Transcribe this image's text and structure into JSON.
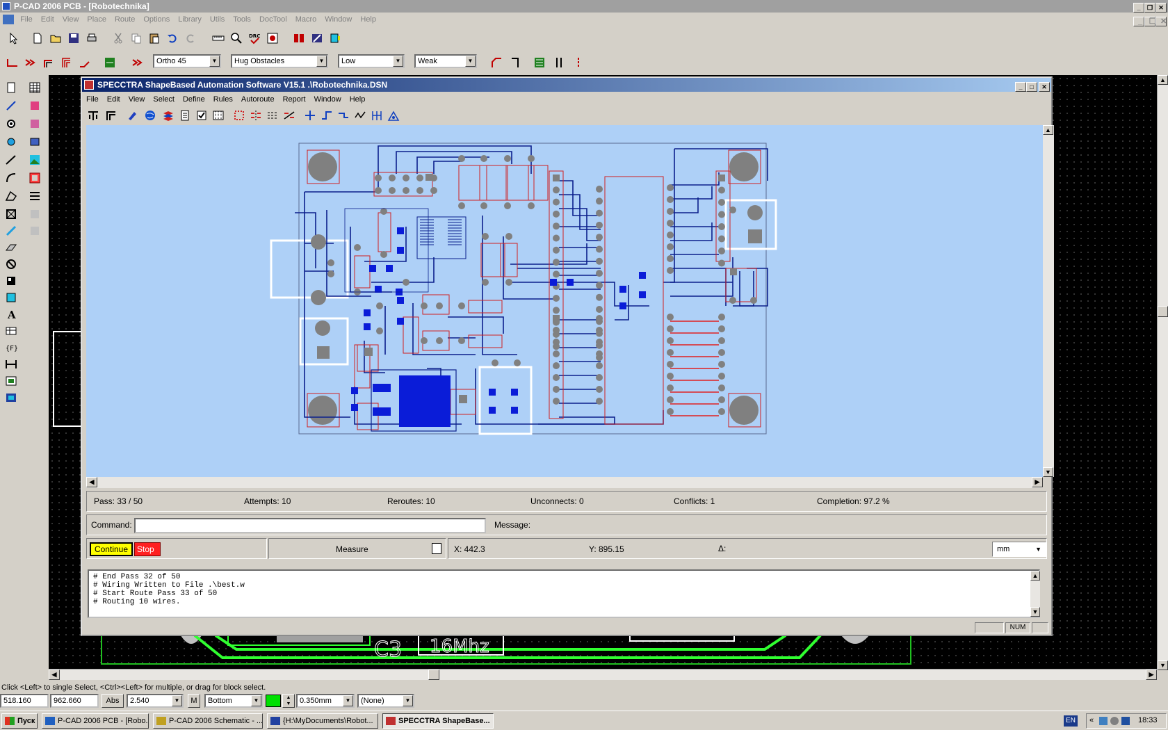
{
  "app": {
    "title": "P-CAD 2006 PCB - [Robotechnika]",
    "menu": [
      "File",
      "Edit",
      "View",
      "Place",
      "Route",
      "Options",
      "Library",
      "Utils",
      "Tools",
      "DocTool",
      "Macro",
      "Window",
      "Help"
    ]
  },
  "route_toolbar": {
    "mode": "Ortho 45",
    "obstacle": "Hug Obstacles",
    "level": "Low",
    "strength": "Weak"
  },
  "specctra": {
    "title": "SPECCTRA ShapeBased Automation Software V15.1 .\\Robotechnika.DSN",
    "menu": [
      "File",
      "Edit",
      "View",
      "Select",
      "Define",
      "Rules",
      "Autoroute",
      "Report",
      "Window",
      "Help"
    ],
    "stats": {
      "pass": "Pass:  33 / 50",
      "attempts": "Attempts: 10",
      "reroutes": "Reroutes:  10",
      "unconnects": "Unconnects:  0",
      "conflicts": "Conflicts:  1",
      "completion": "Completion:  97.2  %"
    },
    "command_label": "Command:",
    "command_value": "",
    "message_label": "Message:",
    "continue_label": "Continue",
    "stop_label": "Stop",
    "measure_label": "Measure",
    "x_readout": "X: 442.3",
    "y_readout": "Y: 895.15",
    "delta_label": "Δ:",
    "units": "mm",
    "console_lines": "# End Pass 32 of 50\n# Wiring Written to File .\\best.w\n# Start Route Pass 33 of 50\n# Routing 10 wires.",
    "num_indicator": "NUM"
  },
  "status_hint": "Click <Left> to single Select, <Ctrl><Left> for multiple, or drag for block select.",
  "bottom": {
    "x": "518.160",
    "y": "962.660",
    "abs": "Abs",
    "grid": "2.540",
    "m": "M",
    "layer": "Bottom",
    "width": "0.350mm",
    "net": "(None)"
  },
  "taskbar": {
    "start": "Пуск",
    "tasks": [
      "P-CAD 2006 PCB - [Robo...",
      "P-CAD 2006 Schematic - ...",
      "{H:\\MyDocuments\\Robot...",
      "SPECCTRA ShapeBase..."
    ],
    "lang": "EN",
    "time": "18:33"
  },
  "colors": {
    "spectra_bg": "#aed0f7",
    "trace": "#0b1f8c",
    "pad": "#808080",
    "outline": "#d02020",
    "continue_bg": "#ffff00",
    "stop_bg": "#ff0000"
  }
}
